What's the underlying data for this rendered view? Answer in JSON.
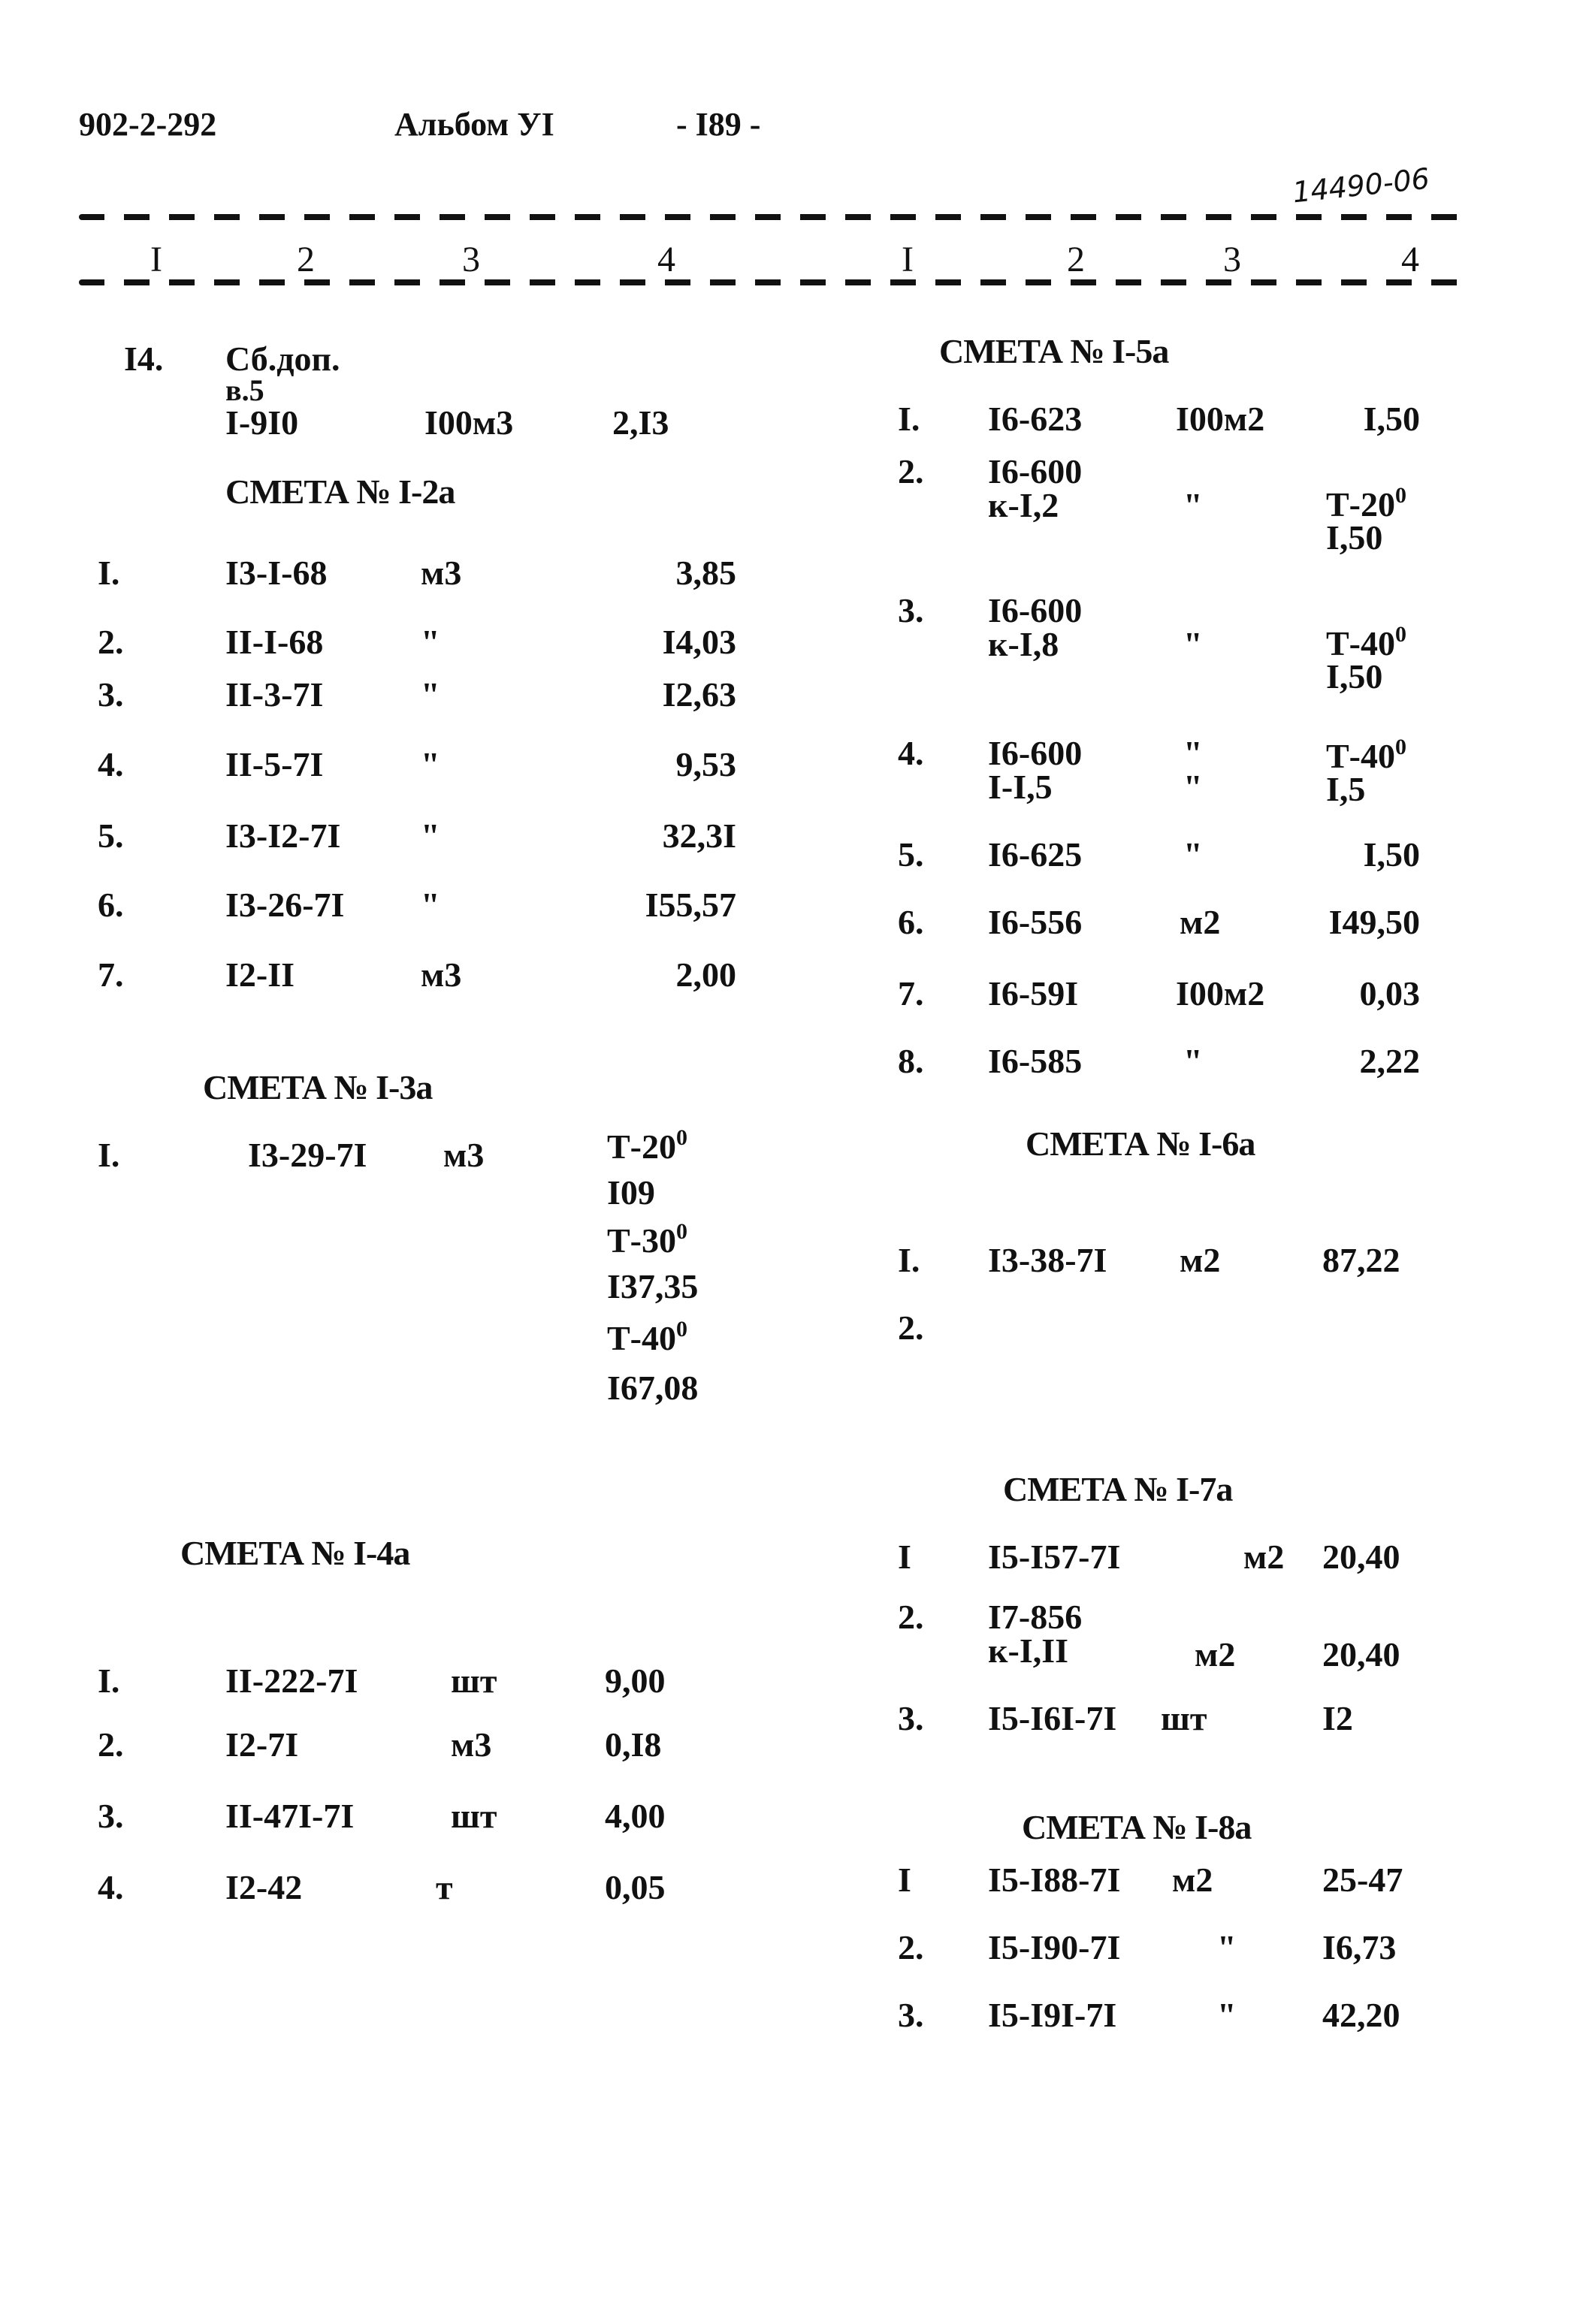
{
  "header": {
    "doc_code": "902-2-292",
    "album": "Альбом УI",
    "page": "- I89 -",
    "stamp": "14490-06"
  },
  "column_headers": [
    "I",
    "2",
    "3",
    "4",
    "I",
    "2",
    "3",
    "4"
  ],
  "left": {
    "item14": {
      "num": "I4.",
      "line1": "Сб.доп.",
      "line2": "в.5",
      "code": "I-9I0",
      "unit": "I00м3",
      "value": "2,I3"
    },
    "smeta_2a": {
      "title": "СМЕТА № I-2а",
      "rows": [
        {
          "num": "I.",
          "code": "I3-I-68",
          "unit": "м3",
          "value": "3,85"
        },
        {
          "num": "2.",
          "code": "II-I-68",
          "unit": "\"",
          "value": "I4,03"
        },
        {
          "num": "3.",
          "code": "II-3-7I",
          "unit": "\"",
          "value": "I2,63"
        },
        {
          "num": "4.",
          "code": "II-5-7I",
          "unit": "\"",
          "value": "9,53"
        },
        {
          "num": "5.",
          "code": "I3-I2-7I",
          "unit": "\"",
          "value": "32,3I"
        },
        {
          "num": "6.",
          "code": "I3-26-7I",
          "unit": "\"",
          "value": "I55,57"
        },
        {
          "num": "7.",
          "code": "I2-II",
          "unit": "м3",
          "value": "2,00"
        }
      ]
    },
    "smeta_3a": {
      "title": "СМЕТА № I-3а",
      "row": {
        "num": "I.",
        "code": "I3-29-7I",
        "unit": "м3"
      },
      "values": [
        {
          "label": "Т-20",
          "deg": "0"
        },
        {
          "label": "I09"
        },
        {
          "label": "Т-30",
          "deg": "0"
        },
        {
          "label": "I37,35"
        },
        {
          "label": "Т-40",
          "deg": "0"
        },
        {
          "label": "I67,08"
        }
      ]
    },
    "smeta_4a": {
      "title": "СМЕТА № I-4а",
      "rows": [
        {
          "num": "I.",
          "code": "II-222-7I",
          "unit": "шт",
          "value": "9,00"
        },
        {
          "num": "2.",
          "code": "I2-7I",
          "unit": "м3",
          "value": "0,I8"
        },
        {
          "num": "3.",
          "code": "II-47I-7I",
          "unit": "шт",
          "value": "4,00"
        },
        {
          "num": "4.",
          "code": "I2-42",
          "unit": "т",
          "value": "0,05"
        }
      ]
    }
  },
  "right": {
    "smeta_5a": {
      "title": "СМЕТА № I-5а",
      "rows": [
        {
          "num": "I.",
          "code": "I6-623",
          "code2": "",
          "unit": "I00м2",
          "unit2": "",
          "v1": "I,50",
          "v2": ""
        },
        {
          "num": "2.",
          "code": "I6-600",
          "code2": "к-I,2",
          "unit": "\"",
          "unit2": "",
          "v1": "Т-20",
          "deg": "0",
          "v2": "I,50"
        },
        {
          "num": "3.",
          "code": "I6-600",
          "code2": "к-I,8",
          "unit": "\"",
          "unit2": "",
          "v1": "Т-40",
          "deg": "0",
          "v2": "I,50"
        },
        {
          "num": "4.",
          "code": "I6-600",
          "code2": "I-I,5",
          "unit": "\"",
          "unit2": "\"",
          "v1": "Т-40",
          "deg": "0",
          "v2": "I,5"
        },
        {
          "num": "5.",
          "code": "I6-625",
          "code2": "",
          "unit": "\"",
          "unit2": "",
          "v1": "I,50",
          "v2": ""
        },
        {
          "num": "6.",
          "code": "I6-556",
          "code2": "",
          "unit": "м2",
          "unit2": "",
          "v1": "I49,50",
          "v2": ""
        },
        {
          "num": "7.",
          "code": "I6-59I",
          "code2": "",
          "unit": "I00м2",
          "unit2": "",
          "v1": "0,03",
          "v2": ""
        },
        {
          "num": "8.",
          "code": "I6-585",
          "code2": "",
          "unit": "\"",
          "unit2": "",
          "v1": "2,22",
          "v2": ""
        }
      ]
    },
    "smeta_6a": {
      "title": "СМЕТА № I-6а",
      "rows": [
        {
          "num": "I.",
          "code": "I3-38-7I",
          "unit": "м2",
          "value": "87,22"
        },
        {
          "num": "2.",
          "code": "",
          "unit": "",
          "value": ""
        }
      ]
    },
    "smeta_7a": {
      "title": "СМЕТА № I-7а",
      "rows": [
        {
          "num": "I",
          "code": "I5-I57-7I",
          "code2": "",
          "unit": "м2",
          "value": "20,40"
        },
        {
          "num": "2.",
          "code": "I7-856",
          "code2": "к-I,II",
          "unit": "м2",
          "value": "20,40"
        },
        {
          "num": "3.",
          "code": "I5-I6I-7I",
          "code2": "",
          "unit": "шт",
          "value": "I2"
        }
      ]
    },
    "smeta_8a": {
      "title": "СМЕТА № I-8а",
      "rows": [
        {
          "num": "I",
          "code": "I5-I88-7I",
          "unit": "м2",
          "value": "25-47"
        },
        {
          "num": "2.",
          "code": "I5-I90-7I",
          "unit": "\"",
          "value": "I6,73"
        },
        {
          "num": "3.",
          "code": "I5-I9I-7I",
          "unit": "\"",
          "value": "42,20"
        }
      ]
    }
  }
}
